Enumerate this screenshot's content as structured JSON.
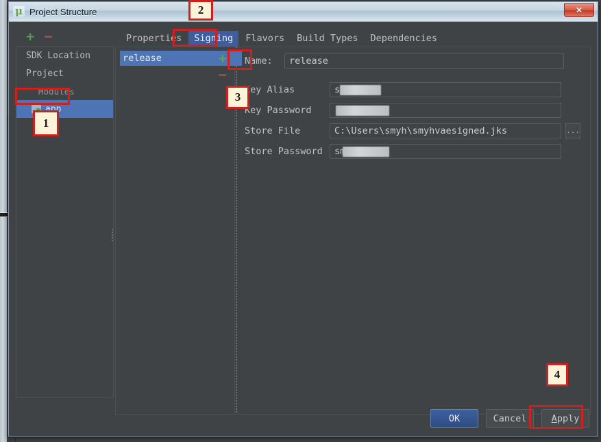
{
  "window": {
    "title": "Project Structure",
    "app_icon": "android-studio-icon",
    "close_label": "✕"
  },
  "left_panel": {
    "add_label": "+",
    "remove_label": "−",
    "items": [
      {
        "label": "SDK Location",
        "type": "item",
        "selected": false
      },
      {
        "label": "Project",
        "type": "item",
        "selected": false
      },
      {
        "label": "Modules",
        "type": "group",
        "selected": false
      },
      {
        "label": "app",
        "type": "child",
        "selected": true,
        "icon": "folder-icon"
      }
    ]
  },
  "tabs": [
    {
      "label": "Properties",
      "selected": false
    },
    {
      "label": "Signing",
      "selected": true
    },
    {
      "label": "Flavors",
      "selected": false
    },
    {
      "label": "Build Types",
      "selected": false
    },
    {
      "label": "Dependencies",
      "selected": false
    }
  ],
  "signing_list": {
    "items": [
      {
        "label": "release",
        "selected": true
      }
    ],
    "add_label": "+",
    "remove_label": "−"
  },
  "form": {
    "name": {
      "label": "Name:",
      "value": "release"
    },
    "fields": [
      {
        "label": "Key Alias",
        "value": "s",
        "masked": true,
        "mask_width": 60
      },
      {
        "label": "Key Password",
        "value": "",
        "masked": true,
        "mask_width": 78
      },
      {
        "label": "Store File",
        "value": "C:\\Users\\smyh\\smyhvaesigned.jks",
        "masked": false,
        "browse": "..."
      },
      {
        "label": "Store Password",
        "value": "sm",
        "masked": true,
        "mask_width": 68
      }
    ]
  },
  "buttons": {
    "ok": "OK",
    "cancel": "Cancel",
    "apply_mnemonic": "A",
    "apply_rest": "pply"
  },
  "annotations": [
    {
      "id": "1",
      "text": "1"
    },
    {
      "id": "2",
      "text": "2"
    },
    {
      "id": "3",
      "text": "3"
    },
    {
      "id": "4",
      "text": "4"
    }
  ],
  "colors": {
    "accent_selection": "#4d74b5",
    "annotation_red": "#cf2020",
    "annotation_fill": "#fdf3d8",
    "window_bg": "#3f4346",
    "plus_green": "#5ca94f",
    "minus_red": "#b45b52"
  }
}
